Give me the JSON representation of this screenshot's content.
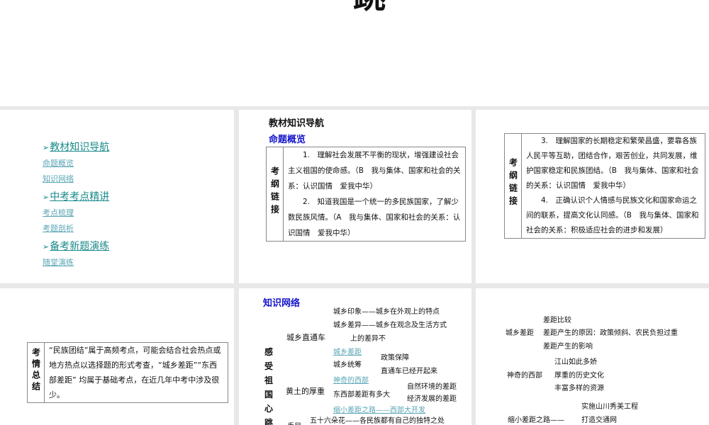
{
  "header": {
    "title_fragment": "跳"
  },
  "nav": {
    "sections": [
      {
        "label": "教材知识导航",
        "items": [
          "命题概览",
          "知识网络"
        ]
      },
      {
        "label": "中考考点精讲",
        "items": [
          "考点梳理",
          "考题剖析"
        ]
      },
      {
        "label": "备考新题演练",
        "items": [
          "随堂演练"
        ]
      }
    ]
  },
  "slide2": {
    "title": "教材知识导航",
    "subtitle": "命题概览",
    "label": "考纲链接",
    "p1": "1.　理解社会发展不平衡的现状，增强建设社会主义祖国的使命感。（B　我与集体、国家和社会的关系：认识国情　爱我中华）",
    "p2": "2.　知道我国是一个统一的多民族国家，了解少数民族风情。（A　我与集体、国家和社会的关系：认识国情　爱我中华）"
  },
  "slide3": {
    "label": "考纲链接",
    "p3": "3.　理解国家的长期稳定和繁荣昌盛，要靠各族人民平等互助，团结合作，艰苦创业，共同发展，维护国家稳定和民族团结。（B　我与集体、国家和社会的关系：认识国情　爱我中华）",
    "p4": "4.　正确认识个人情感与民族文化和国家命运之间的联系，提高文化认同感。（B　我与集体、国家和社会的关系：积极适应社会的进步和发展）"
  },
  "slide4": {
    "label": "考情总结",
    "text": "“民族团结”属于高频考点，可能会结合社会热点或地方热点以选择题的形式考查，“城乡差距”“东西部差距” 均属于基础考点，在近几年中考中涉及很少。"
  },
  "slide5": {
    "title": "知识网络",
    "root": "感受祖国心跳",
    "n1": "城乡直通车",
    "n1a": "城乡印象——城乡在外观上的特点",
    "n1b": "城乡差异——城乡在观念及生活方式",
    "n1b2": "上的差异不",
    "n1c": "城乡差距",
    "n1d": "城乡统筹",
    "n1d1": "政策保障",
    "n1d2": "直通车已经开起来",
    "n2": "黄土的厚重",
    "n2a": "神奇的西部",
    "n2b": "东西部差距有多大",
    "n2b1": "自然环境的差距",
    "n2b2": "经济发展的差距",
    "n2c": "缩小差距之路——西部大开发",
    "n3": "手足",
    "n3a": "五十六朵花——各民族都有自己的独特之处"
  },
  "slide6": {
    "g1": "城乡差距",
    "g1a": "差距比较",
    "g1b": "差距产生的原因：政策倾斜、农民负担过重",
    "g1c": "差距产生的影响",
    "g2": "神奇的西部",
    "g2a": "江山如此多娇",
    "g2b": "厚重的历史文化",
    "g2c": "丰富多样的资源",
    "g3": "缩小差距之路——",
    "g3a": "实施山川秀美工程",
    "g3b": "打造交通网"
  }
}
